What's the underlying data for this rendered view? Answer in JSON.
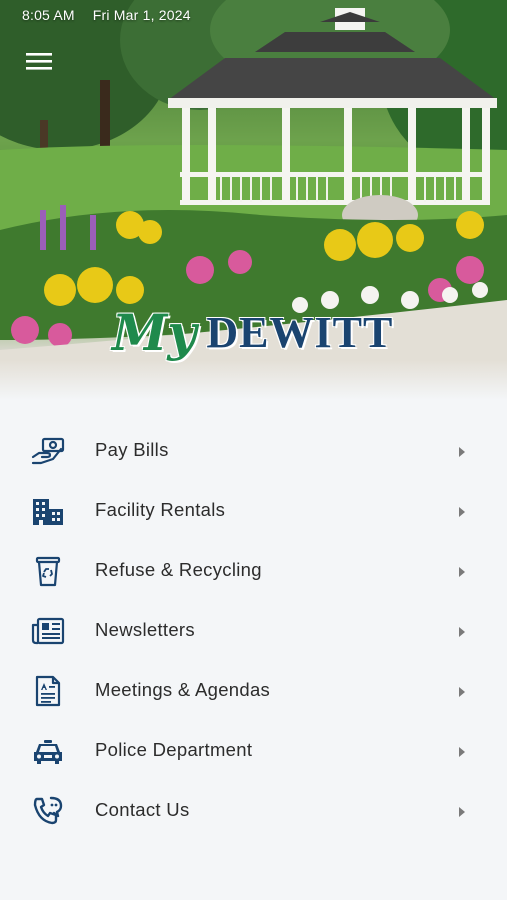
{
  "status_bar": {
    "time": "8:05 AM",
    "date": "Fri Mar 1, 2024"
  },
  "header": {
    "menu_icon": "hamburger-icon",
    "logo": {
      "my": "My",
      "name": "DEWITT"
    }
  },
  "colors": {
    "icon_navy": "#1a4470",
    "logo_green": "#1f8a4c",
    "logo_navy": "#1a4470",
    "label": "#2c2c2c",
    "chevron": "#7a7a7a",
    "background": "#f4f6f8"
  },
  "menu": {
    "items": [
      {
        "label": "Pay Bills",
        "icon": "hand-money-icon"
      },
      {
        "label": "Facility Rentals",
        "icon": "buildings-icon"
      },
      {
        "label": "Refuse & Recycling",
        "icon": "recycle-bin-icon"
      },
      {
        "label": "Newsletters",
        "icon": "newspaper-icon"
      },
      {
        "label": "Meetings & Agendas",
        "icon": "document-icon"
      },
      {
        "label": "Police Department",
        "icon": "police-car-icon"
      },
      {
        "label": "Contact Us",
        "icon": "phone-chat-icon"
      }
    ]
  }
}
